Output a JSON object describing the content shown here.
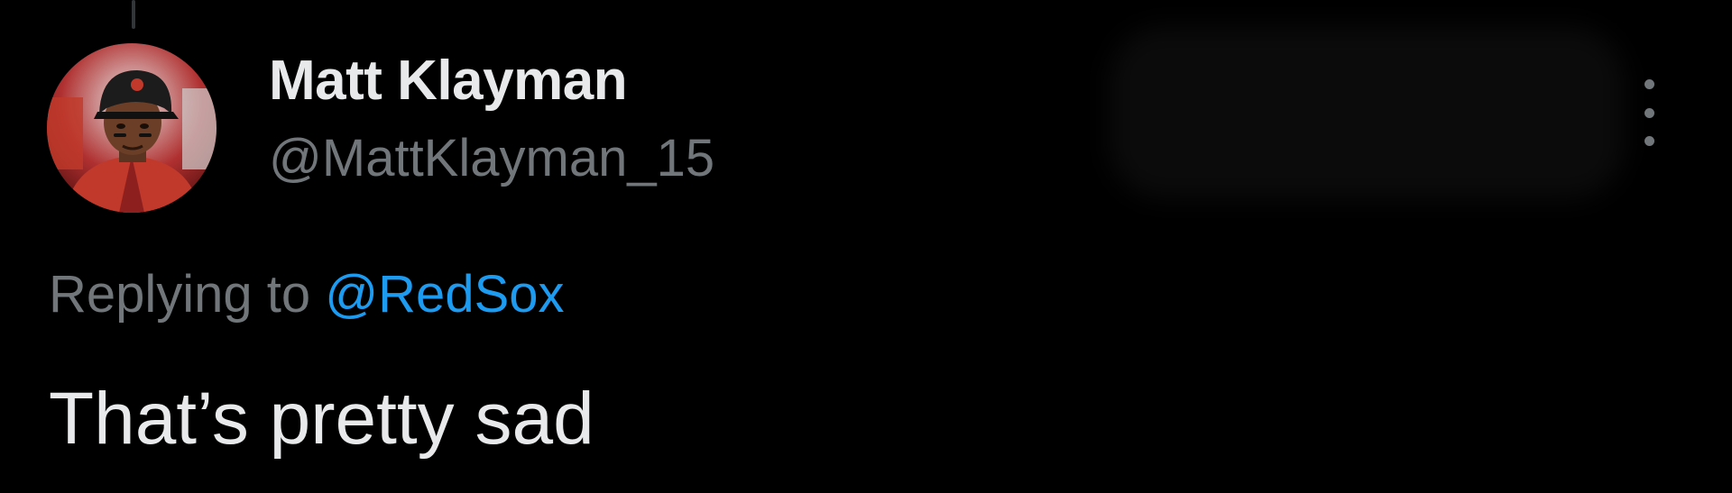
{
  "author": {
    "display_name": "Matt Klayman",
    "handle": "@MattKlayman_15",
    "avatar_icon": "baseball-player-avatar"
  },
  "reply": {
    "prefix": "Replying to",
    "target": "@RedSox"
  },
  "tweet": {
    "text": "That’s pretty sad"
  },
  "menu": {
    "icon": "more-vertical-icon"
  },
  "colors": {
    "background": "#000000",
    "primary_text": "#e7e9ea",
    "secondary_text": "#71767b",
    "link": "#1d9bf0"
  }
}
